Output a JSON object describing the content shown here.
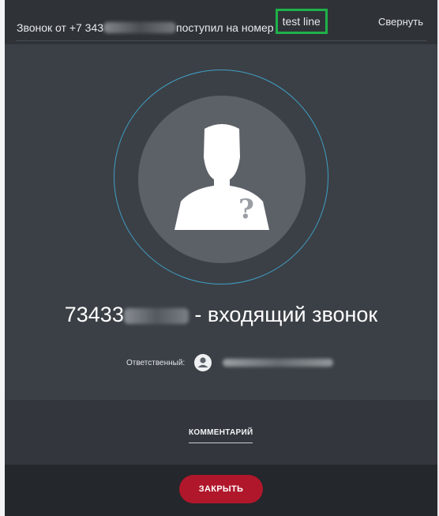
{
  "header": {
    "title_prefix": "Звонок от +7 343",
    "title_middle": "поступил на номер",
    "line_name": "test line",
    "collapse_label": "Свернуть"
  },
  "caller": {
    "number_prefix": "73433",
    "status_text": "- входящий звонок"
  },
  "avatar": {
    "icon": "unknown-person-icon",
    "badge": "?"
  },
  "responsible": {
    "label": "Ответственный:",
    "avatar_icon": "user-icon"
  },
  "comment": {
    "label": "КОММЕНТАРИЙ"
  },
  "footer": {
    "close_label": "ЗАКРЫТЬ"
  },
  "colors": {
    "dialog_bg": "#3b4046",
    "ring": "#3f9fc4",
    "highlight_border": "#1fb14a",
    "close_button": "#b0172b"
  }
}
